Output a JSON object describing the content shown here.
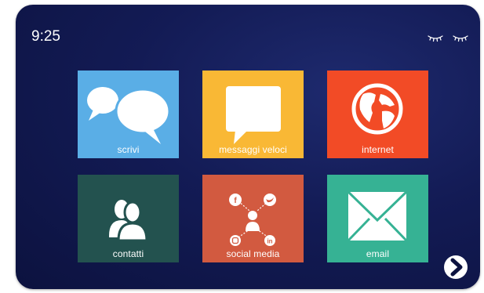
{
  "status": {
    "time": "9:25"
  },
  "colors": {
    "background": "#131b55",
    "scrivi": "#5aaee6",
    "messaggi": "#f9b835",
    "internet": "#f24b26",
    "contatti": "#23524f",
    "social": "#d25a40",
    "email": "#36b294"
  },
  "tiles": [
    {
      "label": "scrivi",
      "icon": "speech-bubbles-icon"
    },
    {
      "label": "messaggi veloci",
      "icon": "message-bubble-icon"
    },
    {
      "label": "internet",
      "icon": "globe-icon"
    },
    {
      "label": "contatti",
      "icon": "contacts-icon"
    },
    {
      "label": "social media",
      "icon": "social-network-icon"
    },
    {
      "label": "email",
      "icon": "envelope-icon"
    }
  ],
  "icons": {
    "eyes": "closed-eyes-icon",
    "next": "chevron-right-icon"
  }
}
